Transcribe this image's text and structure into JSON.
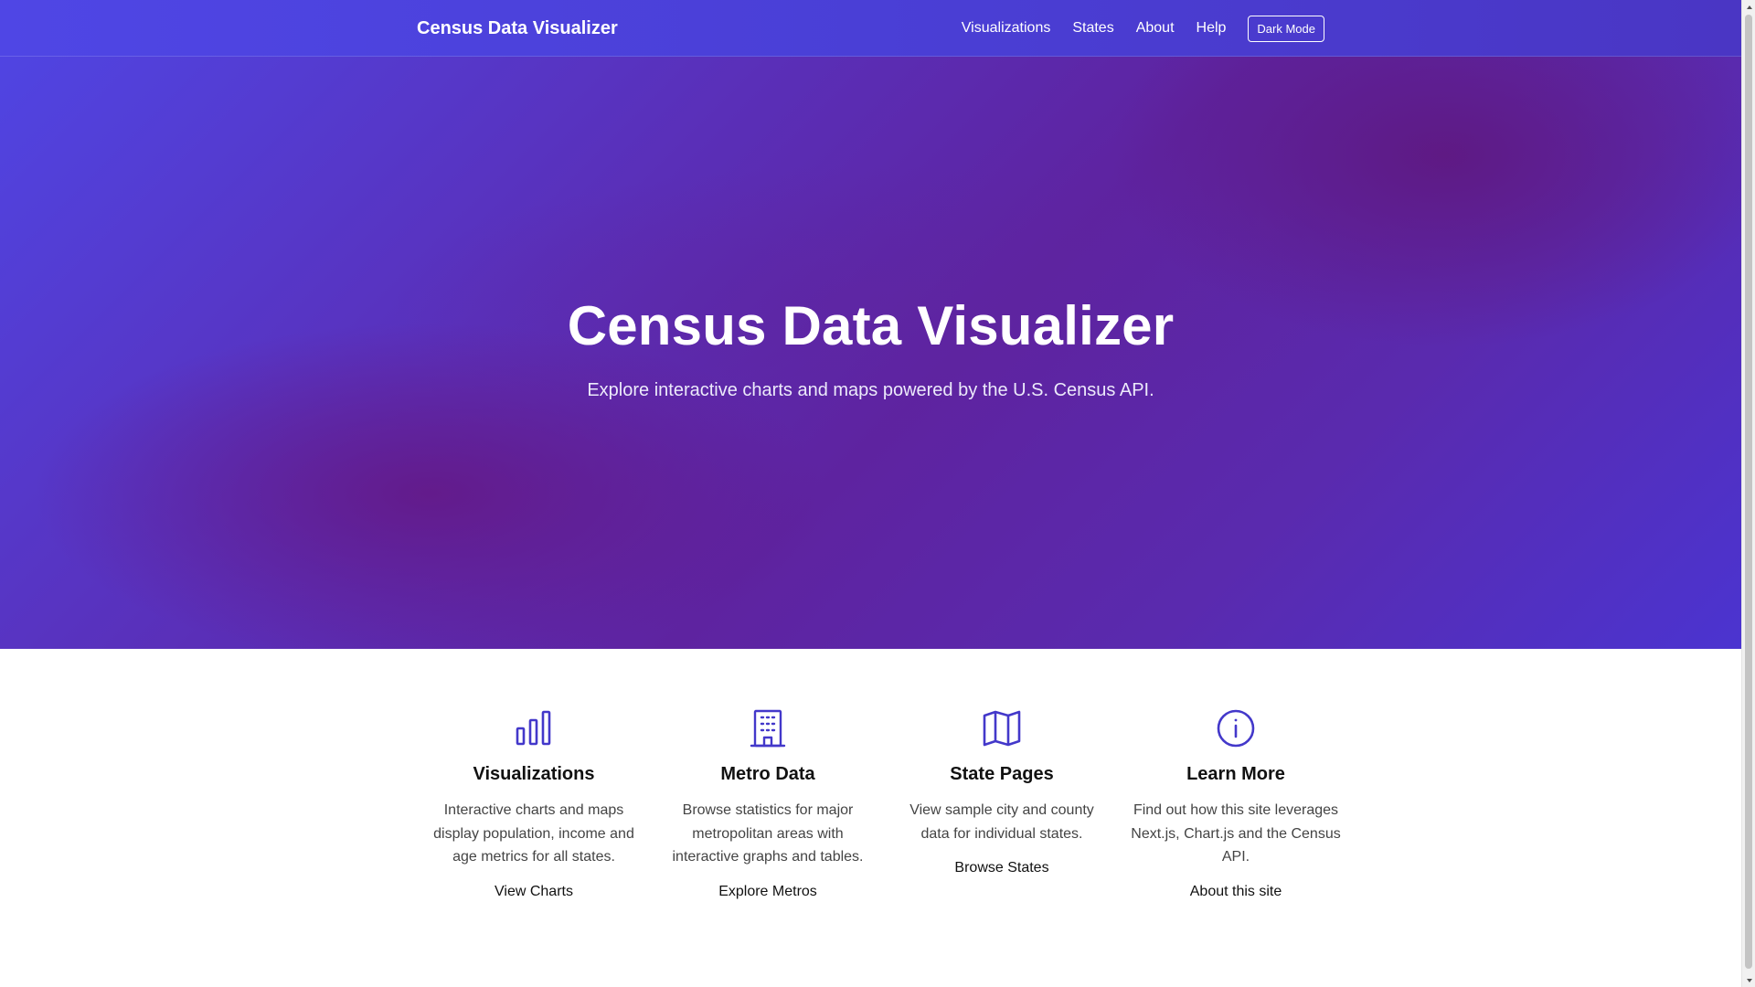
{
  "navbar": {
    "brand": "Census Data Visualizer",
    "links": [
      "Visualizations",
      "States",
      "About",
      "Help"
    ],
    "dark_mode_label": "Dark Mode"
  },
  "hero": {
    "title": "Census Data Visualizer",
    "subtitle": "Explore interactive charts and maps powered by the U.S. Census API."
  },
  "features": [
    {
      "icon": "bar-chart-icon",
      "title": "Visualizations",
      "description": "Interactive charts and maps display population, income and age metrics for all states.",
      "link": "View Charts"
    },
    {
      "icon": "building-icon",
      "title": "Metro Data",
      "description": "Browse statistics for major metropolitan areas with interactive graphs and tables.",
      "link": "Explore Metros"
    },
    {
      "icon": "map-icon",
      "title": "State Pages",
      "description": "View sample city and county data for individual states.",
      "link": "Browse States"
    },
    {
      "icon": "info-icon",
      "title": "Learn More",
      "description": "Find out how this site leverages Next.js, Chart.js and the Census API.",
      "link": "About this site"
    }
  ],
  "colors": {
    "accent": "#4f46e5",
    "hero_dark": "#5e23a0",
    "icon": "#4338ca"
  }
}
